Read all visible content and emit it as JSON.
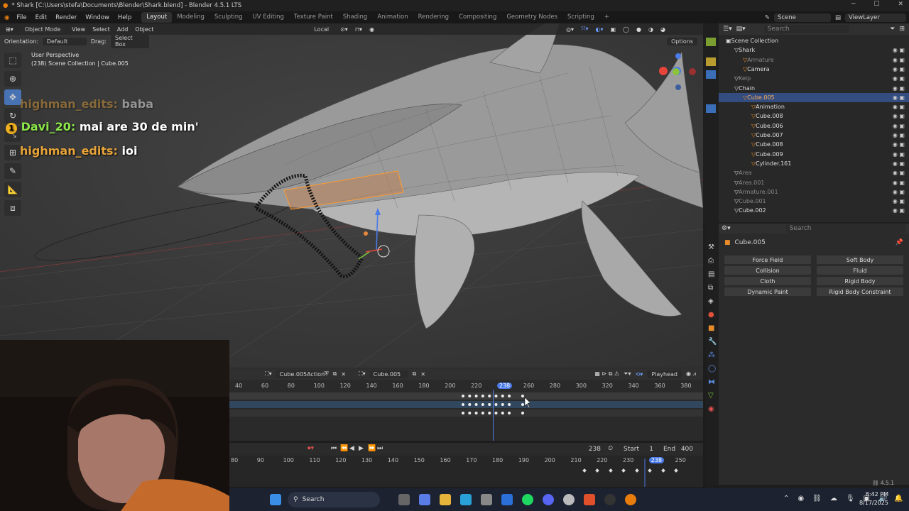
{
  "window": {
    "title": "* Shark [C:\\Users\\stefa\\Documents\\Blender\\Shark.blend] - Blender 4.5.1 LTS"
  },
  "menu": [
    "File",
    "Edit",
    "Render",
    "Window",
    "Help"
  ],
  "workspaces": [
    "Layout",
    "Modeling",
    "Sculpting",
    "UV Editing",
    "Texture Paint",
    "Shading",
    "Animation",
    "Rendering",
    "Compositing",
    "Geometry Nodes",
    "Scripting"
  ],
  "active_workspace": "Layout",
  "scene_name": "Scene",
  "view_layer": "ViewLayer",
  "viewport": {
    "mode": "Object Mode",
    "menus": [
      "View",
      "Select",
      "Add",
      "Object"
    ],
    "transform_space": "Local",
    "orientation_label": "Orientation:",
    "orientation_value": "Default",
    "drag_label": "Drag:",
    "drag_value": "Select Box",
    "options_label": "Options",
    "perspective": "User Perspective",
    "collection_info": "(238) Scene Collection | Cube.005"
  },
  "chat": [
    {
      "user": "highman_edits:",
      "msg": "baba",
      "faded": true
    },
    {
      "user": "Davi_20:",
      "msg": "mai are 30 de min'",
      "faded": false
    },
    {
      "user": "highman_edits:",
      "msg": "ioi",
      "faded": false
    }
  ],
  "outliner": {
    "search_placeholder": "Search",
    "rows": [
      {
        "label": "Scene Collection",
        "indent": 0
      },
      {
        "label": "Shark",
        "indent": 1
      },
      {
        "label": "Armature",
        "indent": 2,
        "dim": true
      },
      {
        "label": "Camera",
        "indent": 2
      },
      {
        "label": "Kelp",
        "indent": 1,
        "dim": true
      },
      {
        "label": "Chain",
        "indent": 1
      },
      {
        "label": "Cube.005",
        "indent": 2,
        "selected": true,
        "orange": true
      },
      {
        "label": "Animation",
        "indent": 3
      },
      {
        "label": "Cube.008",
        "indent": 3
      },
      {
        "label": "Cube.006",
        "indent": 3
      },
      {
        "label": "Cube.007",
        "indent": 3
      },
      {
        "label": "Cube.008",
        "indent": 3
      },
      {
        "label": "Cube.009",
        "indent": 3
      },
      {
        "label": "Cylinder.161",
        "indent": 3
      },
      {
        "label": "Area",
        "indent": 1,
        "dim": true
      },
      {
        "label": "Area.001",
        "indent": 1,
        "dim": true
      },
      {
        "label": "Armature.001",
        "indent": 1,
        "dim": true
      },
      {
        "label": "Cube.001",
        "indent": 1,
        "dim": true
      },
      {
        "label": "Cube.002",
        "indent": 1
      }
    ]
  },
  "properties": {
    "search_placeholder": "Search",
    "object_name": "Cube.005",
    "physics_buttons": [
      "Force Field",
      "Soft Body",
      "Collision",
      "Fluid",
      "Cloth",
      "Rigid Body",
      "Dynamic Paint",
      "Rigid Body Constraint"
    ]
  },
  "dopesheet": {
    "action_name": "Cube.005Action",
    "object_name": "Cube.005",
    "playhead_label": "Playhead",
    "ticks": [
      "40",
      "60",
      "80",
      "100",
      "120",
      "140",
      "160",
      "180",
      "200",
      "220",
      "238",
      "260",
      "280",
      "300",
      "320",
      "340",
      "360",
      "380"
    ]
  },
  "playback": {
    "current_frame": "238",
    "start_label": "Start",
    "start": "1",
    "end_label": "End",
    "end": "400"
  },
  "timeline": {
    "ticks": [
      "80",
      "90",
      "100",
      "110",
      "120",
      "130",
      "140",
      "150",
      "160",
      "170",
      "180",
      "190",
      "200",
      "210",
      "220",
      "230",
      "238",
      "250"
    ]
  },
  "status": {
    "version": "4.5.1",
    "time": "8:42 PM",
    "date": "8/17/2025"
  },
  "taskbar": {
    "search_label": "Search"
  }
}
